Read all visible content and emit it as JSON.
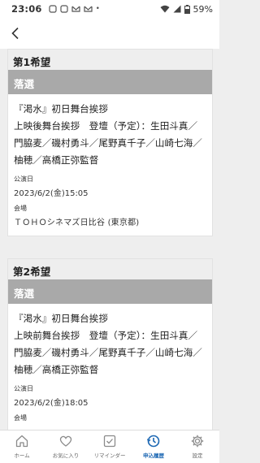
{
  "status_bar": {
    "time": "23:06",
    "battery": "59%"
  },
  "entries": [
    {
      "heading": "第1希望",
      "result": "落選",
      "title_line1": "『渇水』初日舞台挨拶",
      "title_line2": "上映後舞台挨拶　登壇（予定）：生田斗真／門脇麦／磯村勇斗／尾野真千子／山崎七海／柚穂／高橋正弥監督",
      "date_label": "公演日",
      "date_value": "2023/6/2(金)15:05",
      "venue_label": "会場",
      "venue_value": "ＴＯＨＯシネマズ日比谷 (東京都)"
    },
    {
      "heading": "第2希望",
      "result": "落選",
      "title_line1": "『渇水』初日舞台挨拶",
      "title_line2": "上映前舞台挨拶　登壇（予定）：生田斗真／門脇麦／磯村勇斗／尾野真千子／山崎七海／柚穂／高橋正弥監督",
      "date_label": "公演日",
      "date_value": "2023/6/2(金)18:05",
      "venue_label": "会場"
    }
  ],
  "tabs": [
    {
      "label": "ホーム",
      "icon": "home-icon"
    },
    {
      "label": "お気に入り",
      "icon": "heart-icon"
    },
    {
      "label": "リマインダー",
      "icon": "reminder-icon"
    },
    {
      "label": "申込履歴",
      "icon": "history-icon"
    },
    {
      "label": "設定",
      "icon": "gear-icon"
    }
  ],
  "colors": {
    "accent": "#1c67b3",
    "result_bg": "#a9a9a9"
  }
}
